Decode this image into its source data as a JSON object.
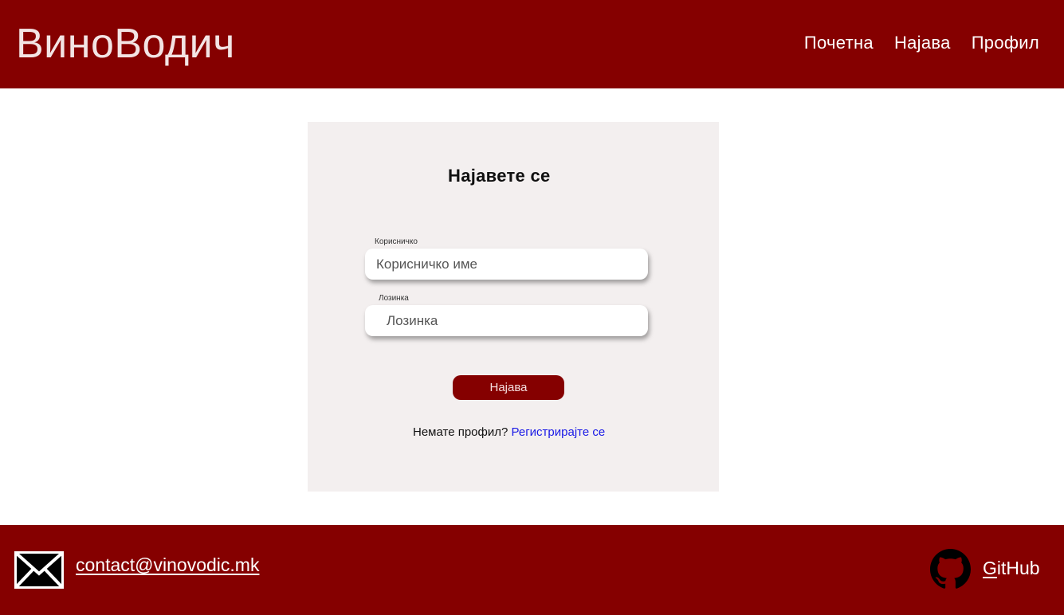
{
  "header": {
    "brand": "ВиноВодич",
    "nav": [
      {
        "label": "Почетна"
      },
      {
        "label": "Најава"
      },
      {
        "label": "Профил"
      }
    ]
  },
  "login": {
    "title": "Најавете се",
    "username_label": "Корисничко име",
    "username_placeholder": "Корисничко име",
    "password_label": "Лозинка",
    "password_placeholder": "Лозинка",
    "submit_label": "Најава",
    "no_account_text": "Немате профил?",
    "register_link": "Регистрирајте се"
  },
  "footer": {
    "email": "contact@vinovodic.mk",
    "github_first": "G",
    "github_rest": "itHub"
  },
  "colors": {
    "brand_red": "#850000",
    "card_bg": "#f3efef",
    "link_blue": "#1a1ae6"
  },
  "icons": {
    "mail": "envelope-icon",
    "github": "github-icon"
  }
}
